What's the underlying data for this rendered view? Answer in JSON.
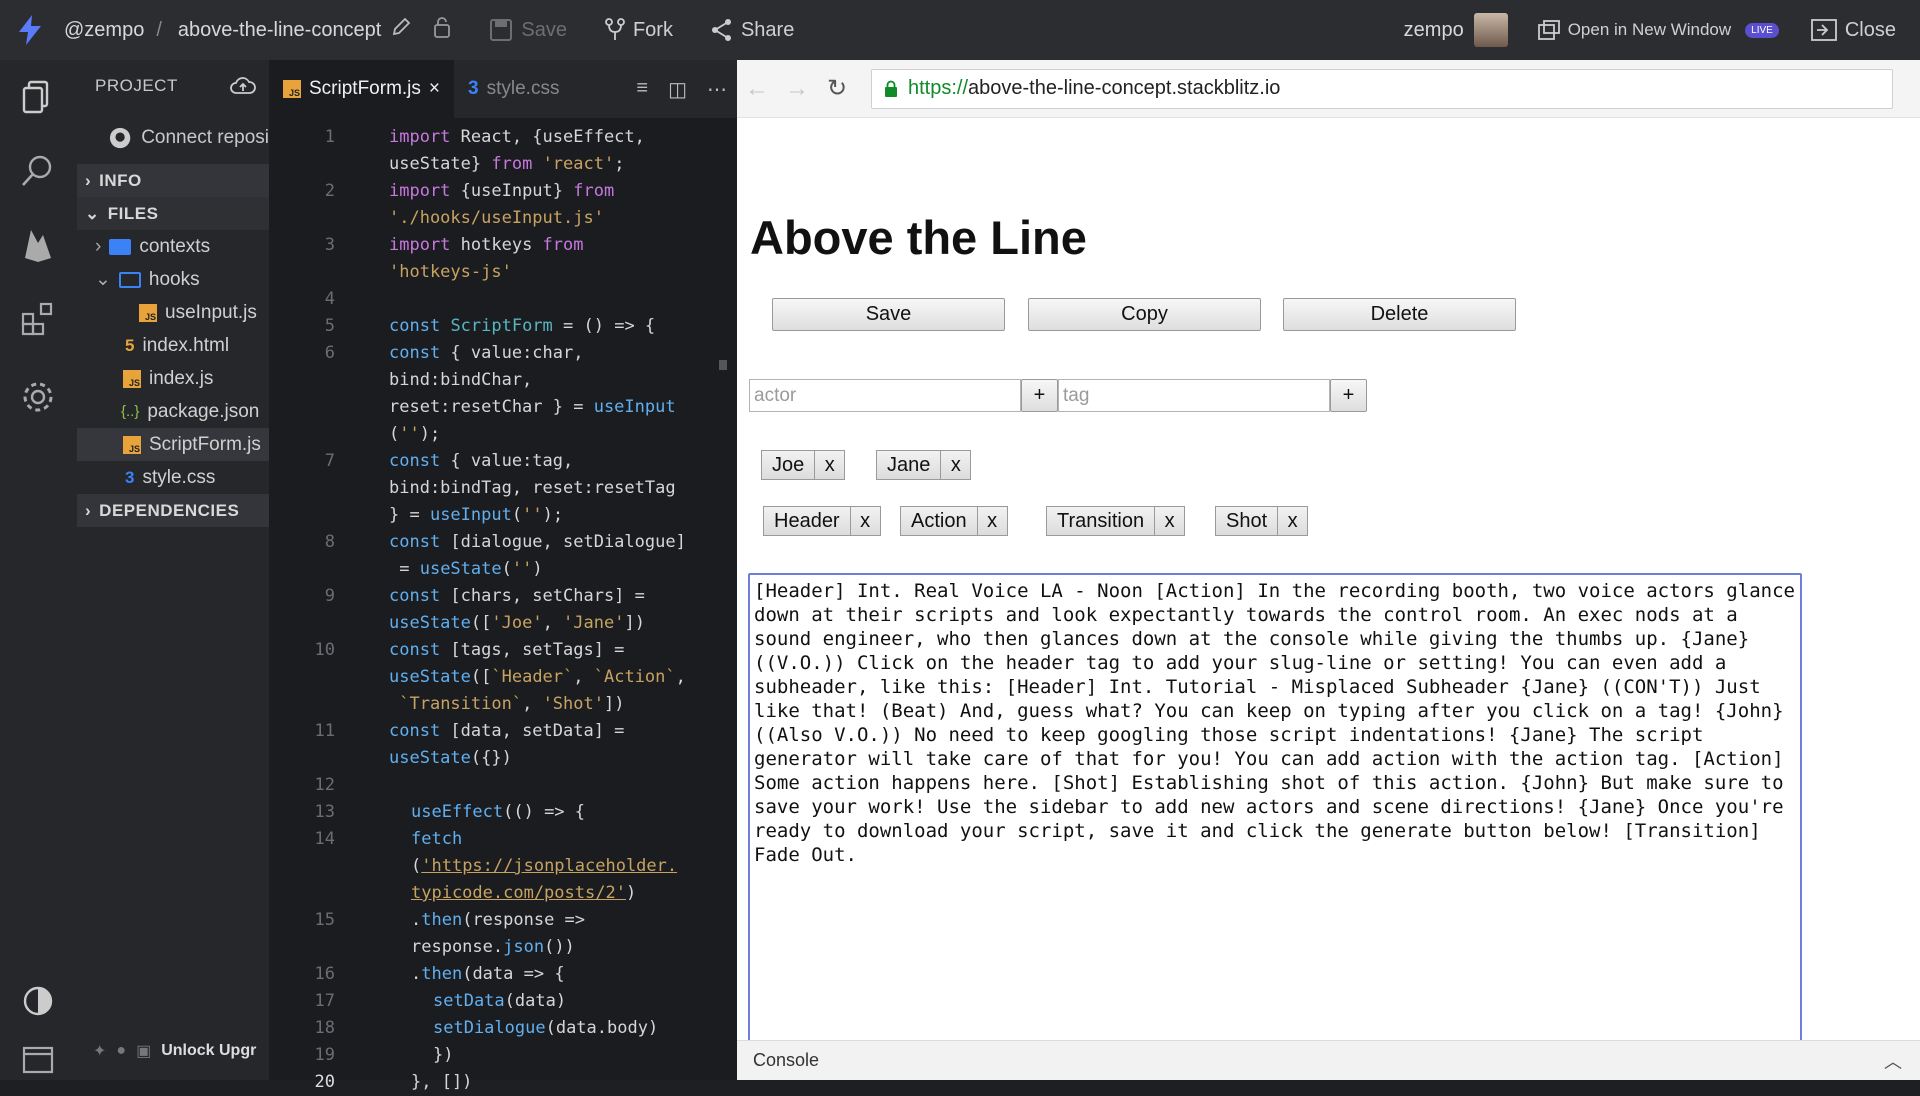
{
  "topbar": {
    "user_handle": "@zempo",
    "separator": "/",
    "project_name": "above-the-line-concept",
    "save_label": "Save",
    "fork_label": "Fork",
    "share_label": "Share",
    "username": "zempo",
    "open_new_window_label": "Open in New Window",
    "live_badge": "LIVE",
    "close_label": "Close"
  },
  "sidebar": {
    "project_header": "PROJECT",
    "connect_repo": "Connect reposi",
    "info_section": "INFO",
    "files_section": "FILES",
    "files": [
      {
        "name": "contexts",
        "type": "folder"
      },
      {
        "name": "hooks",
        "type": "folder-open"
      },
      {
        "name": "useInput.js",
        "type": "js"
      },
      {
        "name": "index.html",
        "type": "html"
      },
      {
        "name": "index.js",
        "type": "js"
      },
      {
        "name": "package.json",
        "type": "json"
      },
      {
        "name": "ScriptForm.js",
        "type": "js"
      },
      {
        "name": "style.css",
        "type": "css"
      }
    ],
    "dependencies_section": "DEPENDENCIES",
    "unlock_label": "Unlock Upgr"
  },
  "editor": {
    "tabs": [
      {
        "label": "ScriptForm.js",
        "active": true
      },
      {
        "label": "style.css",
        "active": false
      }
    ],
    "close_mark": "×"
  },
  "browser": {
    "url_proto": "https://",
    "url_rest": "above-the-line-concept.stackblitz.io",
    "console_label": "Console"
  },
  "app": {
    "title": "Above the Line",
    "buttons": {
      "save": "Save",
      "copy": "Copy",
      "delete": "Delete"
    },
    "actor_placeholder": "actor",
    "tag_placeholder": "tag",
    "plus": "+",
    "remove": "x",
    "actors": [
      "Joe",
      "Jane"
    ],
    "tags": [
      "Header",
      "Action",
      "Transition",
      "Shot"
    ],
    "script_text": "[Header] Int. Real Voice LA - Noon [Action] In the recording booth, two voice actors glance down at their scripts and look expectantly towards the control room. An exec nods at a sound engineer, who then glances down at the console while giving the thumbs up. {Jane} ((V.O.)) Click on the header tag to add your slug-line or setting! You can even add a subheader, like this: [Header] Int. Tutorial - Misplaced Subheader {Jane} ((CON'T)) Just like that! (Beat) And, guess what? You can keep on typing after you click on a tag! {John} ((Also V.O.)) No need to keep googling those script indentations! {Jane} The script generator will take care of that for you! You can add action with the action tag. [Action] Some action happens here. [Shot] Establishing shot of this action. {John} But make sure to save your work! Use the sidebar to add new actors and scene directions! {Jane} Once you're ready to download your script, save it and click the generate button below! [Transition] Fade Out. "
  },
  "colors": {
    "accent": "#5a4fcf",
    "secure_url": "#118a2a",
    "textarea_focus": "#6d7fd6"
  }
}
